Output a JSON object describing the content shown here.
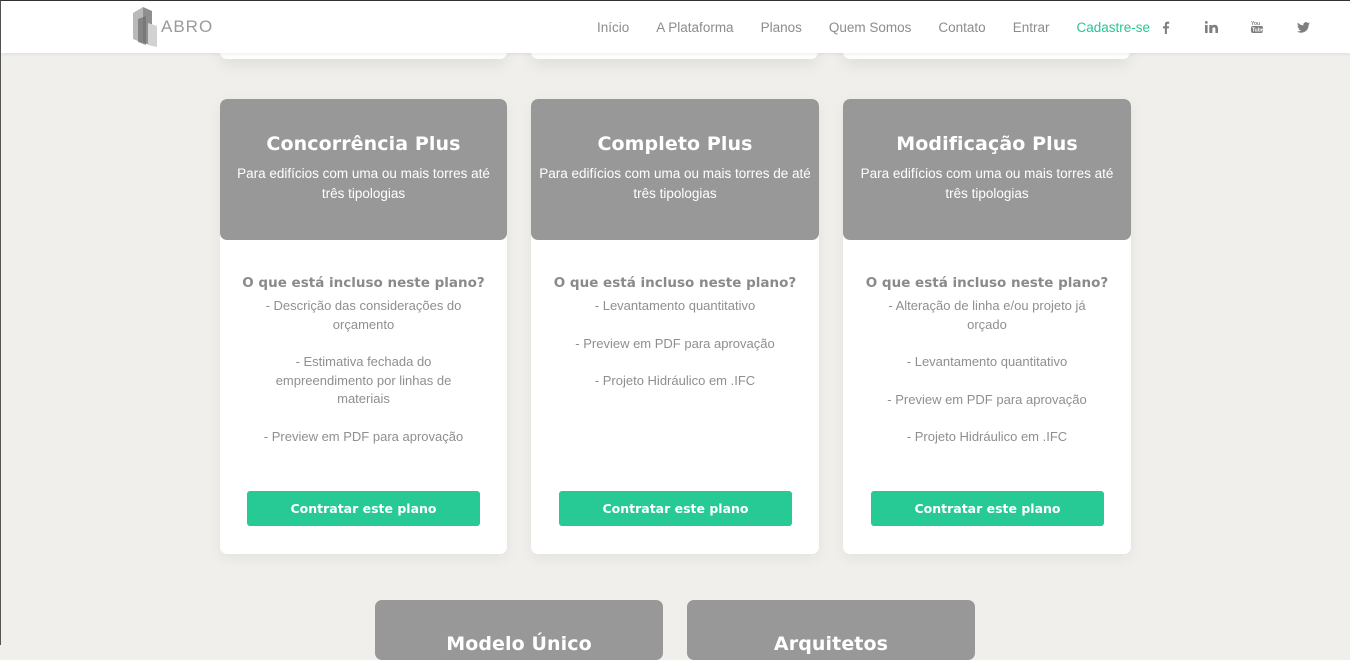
{
  "brand": {
    "logo_text": "ABRO"
  },
  "nav": {
    "links": [
      {
        "label": "Início"
      },
      {
        "label": "A Plataforma"
      },
      {
        "label": "Planos"
      },
      {
        "label": "Quem Somos"
      },
      {
        "label": "Contato"
      },
      {
        "label": "Entrar"
      },
      {
        "label": "Cadastre-se"
      }
    ],
    "social_icons": [
      "facebook-icon",
      "linkedin-icon",
      "youtube-icon",
      "twitter-icon"
    ]
  },
  "colors": {
    "accent": "#27c995",
    "card_header": "#989898",
    "background": "#f0efeb"
  },
  "plans": [
    {
      "title": "Concorrência Plus",
      "subtitle": "Para edifícios com uma ou mais torres até três tipologias",
      "included_title": "O que está incluso neste plano?",
      "features": [
        "- Descrição das considerações do orçamento",
        "- Estimativa fechada do empreendimento por linhas de materiais",
        "- Preview em PDF para aprovação"
      ],
      "cta_label": "Contratar este plano"
    },
    {
      "title": "Completo Plus",
      "subtitle": "Para edifícios com uma ou mais torres de até três tipologias",
      "included_title": "O que está incluso neste plano?",
      "features": [
        "- Levantamento quantitativo",
        "- Preview em PDF para aprovação",
        "- Projeto Hidráulico em .IFC"
      ],
      "cta_label": "Contratar este plano"
    },
    {
      "title": "Modificação Plus",
      "subtitle": "Para edifícios com uma ou mais torres até três tipologias",
      "included_title": "O que está incluso neste plano?",
      "features": [
        "- Alteração de linha e/ou projeto já orçado",
        "- Levantamento quantitativo",
        "- Preview em PDF para aprovação",
        "- Projeto Hidráulico em .IFC"
      ],
      "cta_label": "Contratar este plano"
    }
  ],
  "more_plans": [
    {
      "title": "Modelo Único"
    },
    {
      "title": "Arquitetos"
    }
  ]
}
